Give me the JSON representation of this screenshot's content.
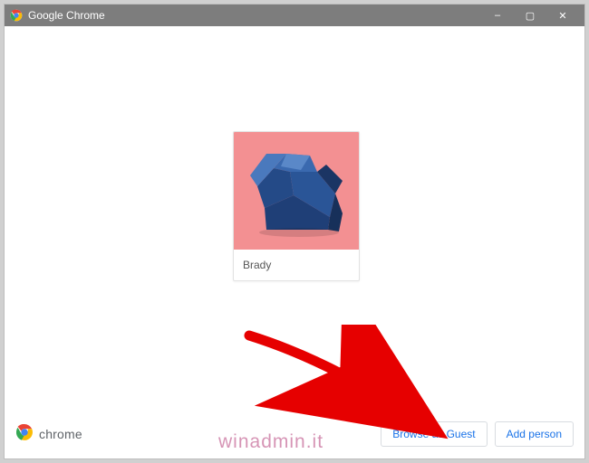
{
  "titlebar": {
    "title": "Google Chrome",
    "minimize_label": "–",
    "maximize_label": "▢",
    "close_label": "✕"
  },
  "profile": {
    "name": "Brady",
    "avatar_bg": "#f39092",
    "avatar_kind": "origami-elephant"
  },
  "footer": {
    "brand_text": "chrome",
    "browse_guest_label": "Browse as Guest",
    "add_person_label": "Add person"
  },
  "watermark": "winadmin.it",
  "colors": {
    "accent_blue": "#1a73e8",
    "titlebar_bg": "#7d7d7d"
  }
}
